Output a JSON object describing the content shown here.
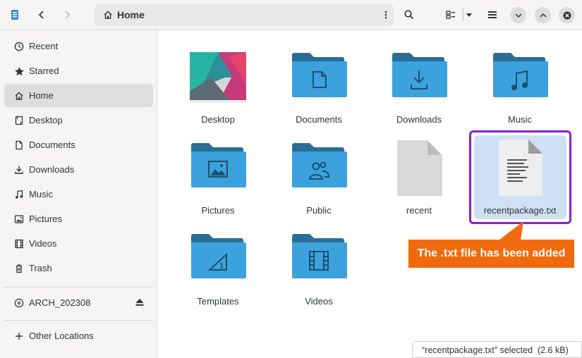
{
  "header": {
    "path_title": "Home",
    "icons": [
      "sidebar-toggle-icon",
      "back-icon",
      "forward-icon",
      "home-icon",
      "more-vertical-icon",
      "search-icon",
      "view-grid-icon",
      "dropdown-icon",
      "hamburger-menu-icon",
      "minimize-icon",
      "maximize-icon",
      "close-icon"
    ]
  },
  "sidebar": {
    "items": [
      {
        "label": "Recent",
        "icon": "clock-icon"
      },
      {
        "label": "Starred",
        "icon": "star-icon"
      },
      {
        "label": "Home",
        "icon": "home-icon",
        "active": true
      },
      {
        "label": "Desktop",
        "icon": "desktop-icon"
      },
      {
        "label": "Documents",
        "icon": "document-icon"
      },
      {
        "label": "Downloads",
        "icon": "download-icon"
      },
      {
        "label": "Music",
        "icon": "music-icon"
      },
      {
        "label": "Pictures",
        "icon": "picture-icon"
      },
      {
        "label": "Videos",
        "icon": "video-icon"
      },
      {
        "label": "Trash",
        "icon": "trash-icon"
      }
    ],
    "devices": [
      {
        "label": "ARCH_202308",
        "icon": "disc-icon"
      }
    ],
    "other": {
      "label": "Other Locations",
      "icon": "plus-icon"
    }
  },
  "files": [
    {
      "name": "Desktop",
      "kind": "desktop-thumbnail"
    },
    {
      "name": "Documents",
      "kind": "folder-documents"
    },
    {
      "name": "Downloads",
      "kind": "folder-downloads"
    },
    {
      "name": "Music",
      "kind": "folder-music"
    },
    {
      "name": "Pictures",
      "kind": "folder-pictures"
    },
    {
      "name": "Public",
      "kind": "folder-public"
    },
    {
      "name": "recent",
      "kind": "file-generic"
    },
    {
      "name": "recentpackage.txt",
      "kind": "file-text",
      "selected": true
    },
    {
      "name": "Templates",
      "kind": "folder-templates"
    },
    {
      "name": "Videos",
      "kind": "folder-videos"
    }
  ],
  "callout": {
    "text": "The .txt file has been added"
  },
  "status": {
    "text": "“recentpackage.txt” selected  (2.6 kB)"
  },
  "colors": {
    "folder_back": "#2a6e96",
    "folder_front": "#3ba2de",
    "selection": "#cfe0f5",
    "highlight_border": "#8a1ed8",
    "callout_bg": "#f26a0e"
  }
}
